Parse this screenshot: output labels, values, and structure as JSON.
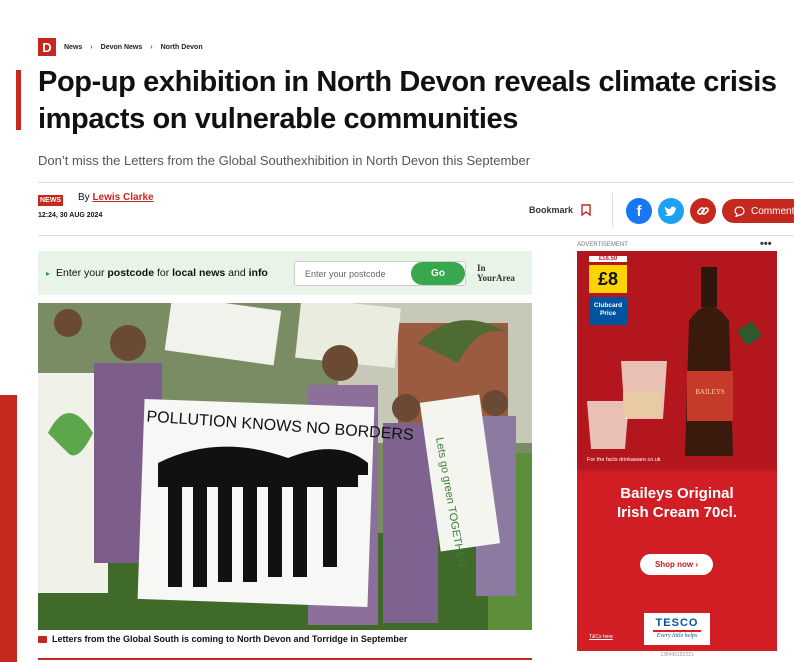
{
  "breadcrumbs": {
    "logo": "D",
    "items": [
      "News",
      "Devon News",
      "North Devon"
    ],
    "separator": "›"
  },
  "article": {
    "headline": "Pop-up exhibition in North Devon reveals climate crisis impacts on vulnerable communities",
    "standfirst": "Don’t miss the Letters from the Global Southexhibition in North Devon this September",
    "tag": "NEWS",
    "by_prefix": "By",
    "author": "Lewis Clarke",
    "timestamp": "12:24, 30 AUG 2024",
    "caption": "Letters from the Global South is coming to North Devon and Torridge in September",
    "sign_text_1": "POLLUTION KNOWS NO BORDERS",
    "sign_text_2": "Lets go green TOGETHER"
  },
  "actions": {
    "bookmark_label": "Bookmark",
    "comment_label": "Comments",
    "facebook_glyph": "f",
    "twitter_glyph": "t",
    "link_glyph": "⊘"
  },
  "postcode": {
    "prefix": "Enter your ",
    "bold1": "postcode",
    "middle": " for ",
    "bold2": "local news",
    "and": " and ",
    "bold3": "info",
    "placeholder": "Enter your postcode",
    "go_label": "Go",
    "brand_line1": "In",
    "brand_line2": "YourArea"
  },
  "advert": {
    "label": "ADVERTISEMENT",
    "menu": "•••",
    "was_price": "£16.50",
    "price": "£8",
    "clubcard": "Clubcard Price",
    "drinkaware": "For the facts drinkaware.co.uk",
    "bottle_brand": "BAILEYS",
    "headline_1": "Baileys Original",
    "headline_2": "Irish Cream 70cl.",
    "shop_label": "Shop now ›",
    "tcs": "T&Cs here",
    "tesco": "TESCO",
    "tesco_tag": "Every little helps",
    "ad_id": "138496152221"
  },
  "colors": {
    "brand_red": "#c4281f",
    "facebook": "#1877f2",
    "twitter": "#1da1f2",
    "go_green": "#37a84d",
    "ad_red": "#c71a22"
  }
}
